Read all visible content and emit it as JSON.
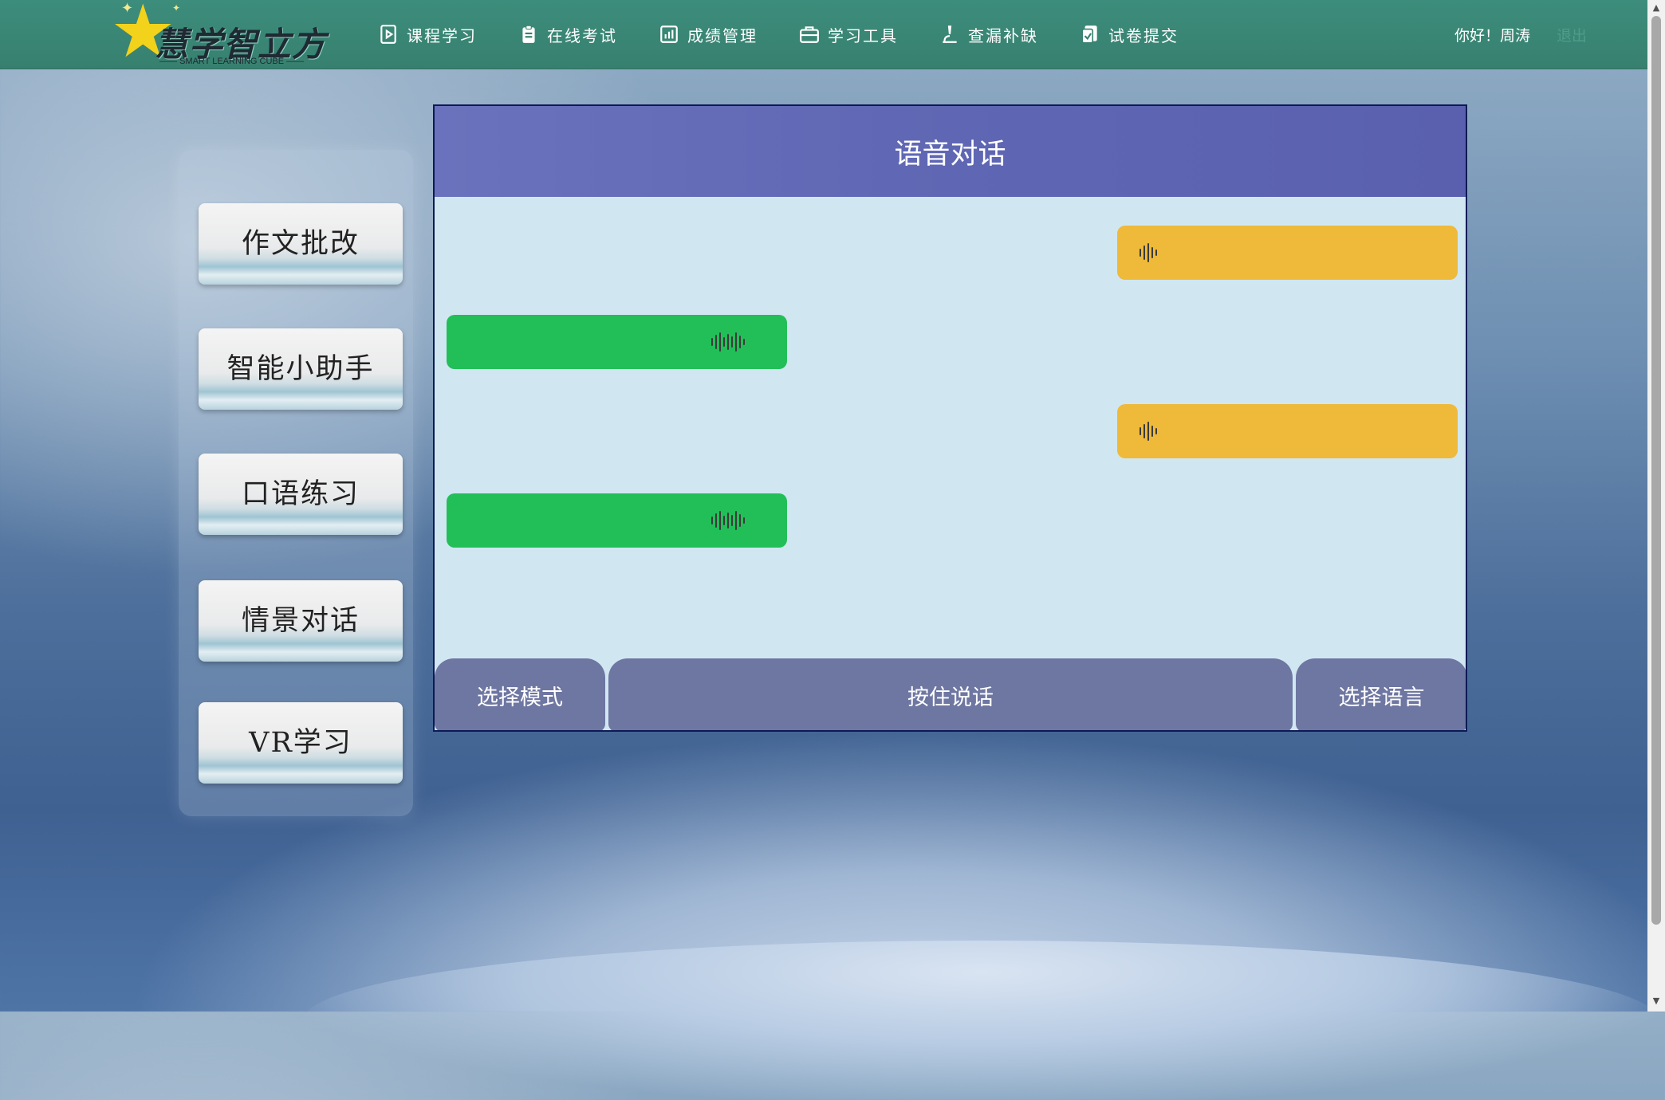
{
  "header": {
    "logo": {
      "brand": "慧学智立方",
      "subtitle": "SMART LEARNING CUBE"
    },
    "nav": [
      {
        "label": "课程学习",
        "icon": "play-document-icon"
      },
      {
        "label": "在线考试",
        "icon": "clipboard-icon"
      },
      {
        "label": "成绩管理",
        "icon": "bar-chart-icon"
      },
      {
        "label": "学习工具",
        "icon": "toolbox-icon"
      },
      {
        "label": "查漏补缺",
        "icon": "microscope-icon"
      },
      {
        "label": "试卷提交",
        "icon": "submit-document-icon"
      }
    ],
    "greeting": "你好！周涛",
    "logout": "退出"
  },
  "sidebar": {
    "items": [
      {
        "label": "作文批改"
      },
      {
        "label": "智能小助手"
      },
      {
        "label": "口语练习"
      },
      {
        "label": "情景对话"
      },
      {
        "label": "VR学习"
      }
    ]
  },
  "main": {
    "title": "语音对话",
    "messages": [
      {
        "side": "right",
        "color": "#efb93a",
        "icon": "audio-wave-icon"
      },
      {
        "side": "left",
        "color": "#22bf58",
        "icon": "audio-wave-icon"
      },
      {
        "side": "right",
        "color": "#efb93a",
        "icon": "audio-wave-icon"
      },
      {
        "side": "left",
        "color": "#22bf58",
        "icon": "audio-wave-icon"
      }
    ],
    "bottom": {
      "mode_label": "选择模式",
      "talk_label": "按住说话",
      "language_label": "选择语言"
    }
  },
  "colors": {
    "topbar": "#3d8d7c",
    "panel_header": "#6068b5",
    "panel_body": "#d0e7f2",
    "bubble_sent": "#efb93a",
    "bubble_received": "#22bf58",
    "bottom_buttons": "#6e76a2"
  }
}
